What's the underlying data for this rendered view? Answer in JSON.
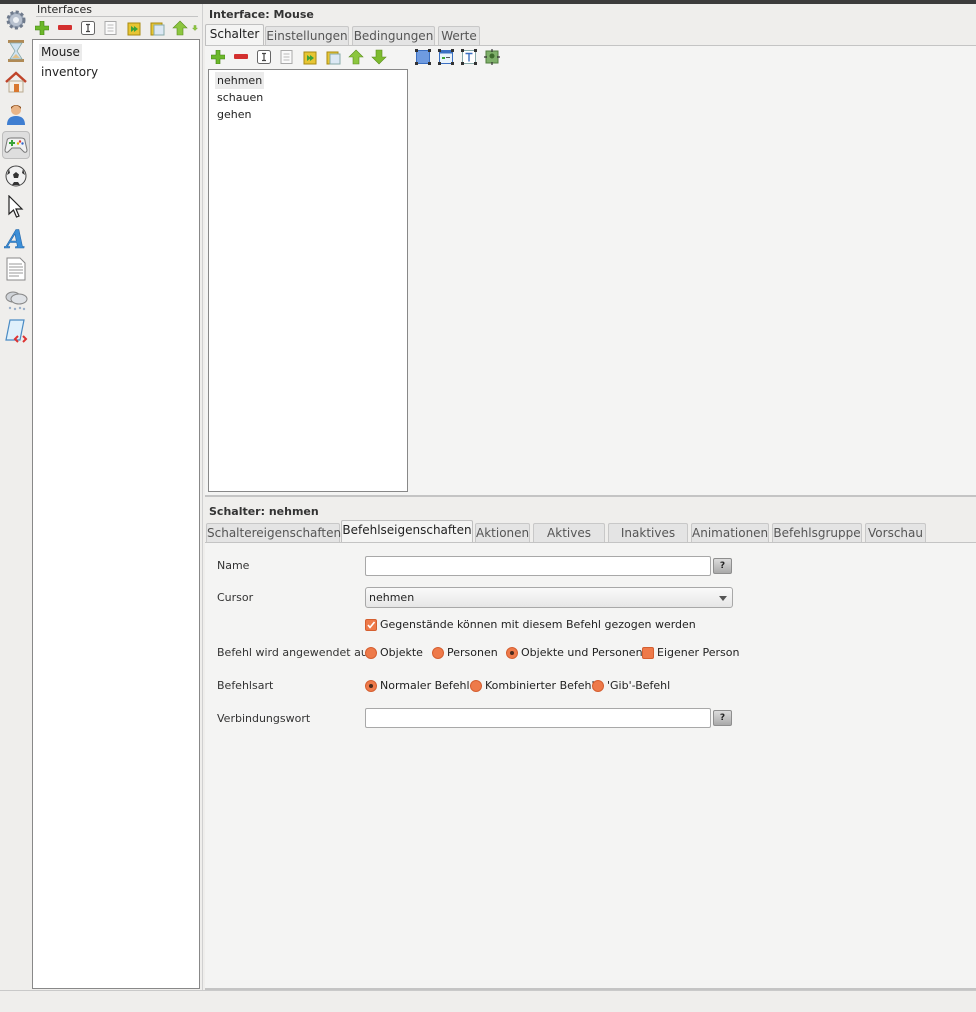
{
  "rail": {
    "items": [
      {
        "icon": "gear-icon"
      },
      {
        "icon": "hourglass-icon"
      },
      {
        "icon": "house-icon"
      },
      {
        "icon": "person-icon"
      },
      {
        "icon": "gamepad-icon",
        "active": true
      },
      {
        "icon": "soccer-ball-icon"
      },
      {
        "icon": "cursor-arrow-icon"
      },
      {
        "icon": "font-a-icon"
      },
      {
        "icon": "document-icon"
      },
      {
        "icon": "weather-cloud-icon"
      },
      {
        "icon": "script-scroll-icon"
      }
    ]
  },
  "left_panel": {
    "title": "Interfaces",
    "toolbar": [
      "add-icon",
      "remove-icon",
      "rename-icon",
      "copy-icon",
      "paste-icon",
      "clipboard-icon",
      "move-up-icon",
      "move-down-icon"
    ],
    "items": [
      {
        "label": "Mouse",
        "selected": true
      },
      {
        "label": "inventory",
        "selected": false
      }
    ]
  },
  "interface_panel": {
    "title": "Interface: Mouse",
    "tabs": [
      {
        "label": "Schalter",
        "active": true
      },
      {
        "label": "Einstellungen",
        "active": false
      },
      {
        "label": "Bedingungen",
        "active": false
      },
      {
        "label": "Werte",
        "active": false
      }
    ],
    "buttons": [
      {
        "label": "nehmen",
        "selected": true
      },
      {
        "label": "schauen",
        "selected": false
      },
      {
        "label": "gehen",
        "selected": false
      }
    ]
  },
  "schalter_panel": {
    "title": "Schalter: nehmen",
    "tabs": [
      {
        "label": "Schaltereigenschaften",
        "active": false
      },
      {
        "label": "Befehlseigenschaften",
        "active": true
      },
      {
        "label": "Aktionen",
        "active": false
      },
      {
        "label": "Aktives Bild",
        "active": false
      },
      {
        "label": "Inaktives Bild",
        "active": false
      },
      {
        "label": "Animationen",
        "active": false
      },
      {
        "label": "Befehlsgruppe",
        "active": false
      },
      {
        "label": "Vorschau",
        "active": false
      }
    ],
    "form": {
      "name_label": "Name",
      "name_value": "",
      "help_label": "?",
      "cursor_label": "Cursor",
      "cursor_value": "nehmen",
      "drag_checkbox_label": "Gegenstände können mit diesem Befehl gezogen werden",
      "drag_checked": true,
      "applies_label": "Befehl wird angewendet auf",
      "applies_options": [
        {
          "label": "Objekte",
          "checked": false
        },
        {
          "label": "Personen",
          "checked": false
        },
        {
          "label": "Objekte und Personen",
          "checked": true
        },
        {
          "label": "Eigener Person",
          "checked": false
        }
      ],
      "type_label": "Befehlsart",
      "type_options": [
        {
          "label": "Normaler Befehl",
          "checked": true
        },
        {
          "label": "Kombinierter Befehl",
          "checked": false
        },
        {
          "label": "'Gib'-Befehl",
          "checked": false
        }
      ],
      "link_word_label": "Verbindungswort",
      "link_word_value": ""
    }
  }
}
